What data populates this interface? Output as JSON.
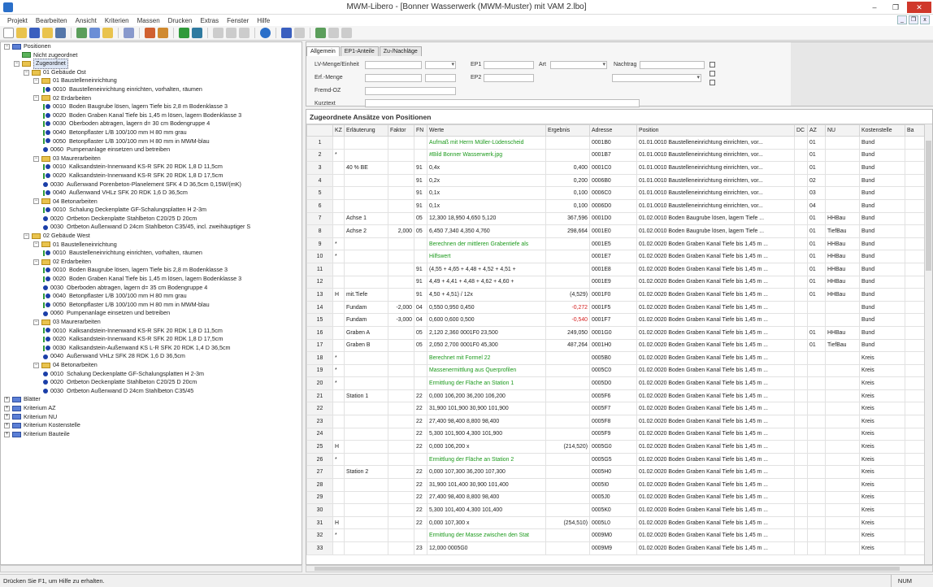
{
  "window": {
    "title": "MWM-Libero - [Bonner Wasserwerk (MWM-Muster) mit VAM 2.lbo]",
    "min_label": "–",
    "max_label": "❐",
    "close_label": "✕"
  },
  "menu": [
    "Projekt",
    "Bearbeiten",
    "Ansicht",
    "Kriterien",
    "Massen",
    "Drucken",
    "Extras",
    "Fenster",
    "Hilfe"
  ],
  "mdi_buttons": [
    "_",
    "❐",
    "x"
  ],
  "tree": {
    "items": [
      {
        "level": 0,
        "exp": "−",
        "icon": "folder-blue",
        "num": "",
        "text": "Positionen"
      },
      {
        "level": 1,
        "exp": "",
        "icon": "folder-green",
        "num": "",
        "text": "Nicht zugeordnet"
      },
      {
        "level": 1,
        "exp": "−",
        "icon": "folder",
        "num": "",
        "text": "Zugeordnet",
        "selected": true
      },
      {
        "level": 2,
        "exp": "−",
        "icon": "folder",
        "num": "",
        "text": "01 Gebäude Ost"
      },
      {
        "level": 3,
        "exp": "−",
        "icon": "folder",
        "num": "",
        "text": "01 Baustelleneinrichtung"
      },
      {
        "level": 4,
        "exp": "",
        "icon": "marks-gd",
        "num": "0010",
        "text": "Baustelleneinrichtung einrichten, vorhalten, räumen"
      },
      {
        "level": 3,
        "exp": "−",
        "icon": "folder",
        "num": "",
        "text": "02 Erdarbeiten"
      },
      {
        "level": 4,
        "exp": "",
        "icon": "marks-gd",
        "num": "0010",
        "text": "Boden Baugrube lösen, lagern Tiefe bis 2,8 m Bodenklasse 3"
      },
      {
        "level": 4,
        "exp": "",
        "icon": "marks-rgd",
        "num": "0020",
        "text": "Boden Graben Kanal Tiefe bis 1,45 m lösen, lagern Bodenklasse 3"
      },
      {
        "level": 4,
        "exp": "",
        "icon": "marks-gd",
        "num": "0030",
        "text": "Oberboden abtragen, lagern d= 30 cm Bodengruppe 4"
      },
      {
        "level": 4,
        "exp": "",
        "icon": "marks-gd",
        "num": "0040",
        "text": "Betonpflaster L/B 100/100 mm H 80 mm grau"
      },
      {
        "level": 4,
        "exp": "",
        "icon": "marks-gd",
        "num": "0050",
        "text": "Betonpflaster L/B 100/100 mm H 80 mm in MWM-blau"
      },
      {
        "level": 4,
        "exp": "",
        "icon": "marks-d",
        "num": "0060",
        "text": "Pumpenanlage einsetzen und betreiben"
      },
      {
        "level": 3,
        "exp": "−",
        "icon": "folder",
        "num": "",
        "text": "03 Maurerarbeiten"
      },
      {
        "level": 4,
        "exp": "",
        "icon": "marks-gd",
        "num": "0010",
        "text": "Kalksandstein-Innenwand KS-R SFK 20 RDK 1,8 D 11,5cm"
      },
      {
        "level": 4,
        "exp": "",
        "icon": "marks-gd",
        "num": "0020",
        "text": "Kalksandstein-Innenwand KS-R SFK 20 RDK 1,8 D 17,5cm"
      },
      {
        "level": 4,
        "exp": "",
        "icon": "marks-d",
        "num": "0030",
        "text": "Außenwand Porenbeton-Planelement SFK 4 D 36,5cm 0,15W/(mK)"
      },
      {
        "level": 4,
        "exp": "",
        "icon": "marks-gd",
        "num": "0040",
        "text": "Außenwand VHLz SFK 20 RDK 1,6 D 36,5cm"
      },
      {
        "level": 3,
        "exp": "−",
        "icon": "folder",
        "num": "",
        "text": "04 Betonarbeiten"
      },
      {
        "level": 4,
        "exp": "",
        "icon": "marks-gd",
        "num": "0010",
        "text": "Schalung Deckenplatte GF-Schalungsplatten H 2-3m"
      },
      {
        "level": 4,
        "exp": "",
        "icon": "marks-d",
        "num": "0020",
        "text": "Ortbeton Deckenplatte Stahlbeton C20/25 D 20cm"
      },
      {
        "level": 4,
        "exp": "",
        "icon": "marks-d",
        "num": "0030",
        "text": "Ortbeton Außenwand D 24cm Stahlbeton C35/45, incl. zweihäuptiger S"
      },
      {
        "level": 2,
        "exp": "−",
        "icon": "folder",
        "num": "",
        "text": "02 Gebäude West"
      },
      {
        "level": 3,
        "exp": "−",
        "icon": "folder",
        "num": "",
        "text": "01 Baustelleneinrichtung"
      },
      {
        "level": 4,
        "exp": "",
        "icon": "marks-gd",
        "num": "0010",
        "text": "Baustelleneinrichtung einrichten, vorhalten, räumen"
      },
      {
        "level": 3,
        "exp": "−",
        "icon": "folder",
        "num": "",
        "text": "02 Erdarbeiten"
      },
      {
        "level": 4,
        "exp": "",
        "icon": "marks-gd",
        "num": "0010",
        "text": "Boden Baugrube lösen, lagern Tiefe bis 2,8 m Bodenklasse 3"
      },
      {
        "level": 4,
        "exp": "",
        "icon": "marks-rgd",
        "num": "0020",
        "text": "Boden Graben Kanal Tiefe bis 1,45 m lösen, lagern Bodenklasse 3"
      },
      {
        "level": 4,
        "exp": "",
        "icon": "marks-d",
        "num": "0030",
        "text": "Oberboden abtragen, lagern d= 35 cm Bodengruppe 4"
      },
      {
        "level": 4,
        "exp": "",
        "icon": "marks-gd",
        "num": "0040",
        "text": "Betonpflaster L/B 100/100 mm H 80 mm grau"
      },
      {
        "level": 4,
        "exp": "",
        "icon": "marks-gd",
        "num": "0050",
        "text": "Betonpflaster L/B 100/100 mm H 80 mm in MWM-blau"
      },
      {
        "level": 4,
        "exp": "",
        "icon": "marks-d",
        "num": "0060",
        "text": "Pumpenanlage einsetzen und betreiben"
      },
      {
        "level": 3,
        "exp": "−",
        "icon": "folder",
        "num": "",
        "text": "03 Maurerarbeiten"
      },
      {
        "level": 4,
        "exp": "",
        "icon": "marks-gd",
        "num": "0010",
        "text": "Kalksandstein-Innenwand KS-R SFK 20 RDK 1,8 D 11,5cm"
      },
      {
        "level": 4,
        "exp": "",
        "icon": "marks-gd",
        "num": "0020",
        "text": "Kalksandstein-Innenwand KS-R SFK 20 RDK 1,8 D 17,5cm"
      },
      {
        "level": 4,
        "exp": "",
        "icon": "marks-gd",
        "num": "0030",
        "text": "Kalksandstein-Außenwand KS L-R SFK 20 RDK 1,4 D 36,5cm"
      },
      {
        "level": 4,
        "exp": "",
        "icon": "marks-d",
        "num": "0040",
        "text": "Außenwand VHLz SFK 28 RDK 1,6 D 36,5cm"
      },
      {
        "level": 3,
        "exp": "−",
        "icon": "folder",
        "num": "",
        "text": "04 Betonarbeiten"
      },
      {
        "level": 4,
        "exp": "",
        "icon": "marks-d",
        "num": "0010",
        "text": "Schalung Deckenplatte GF-Schalungsplatten H 2-3m"
      },
      {
        "level": 4,
        "exp": "",
        "icon": "marks-d",
        "num": "0020",
        "text": "Ortbeton Deckenplatte Stahlbeton C20/25 D 20cm"
      },
      {
        "level": 4,
        "exp": "",
        "icon": "marks-d",
        "num": "0030",
        "text": "Ortbeton Außenwand D 24cm Stahlbeton C35/45"
      },
      {
        "level": 0,
        "exp": "+",
        "icon": "folder-blue",
        "num": "",
        "text": "Blätter"
      },
      {
        "level": 0,
        "exp": "+",
        "icon": "folder-blue",
        "num": "",
        "text": "Kriterium AZ"
      },
      {
        "level": 0,
        "exp": "+",
        "icon": "folder-blue",
        "num": "",
        "text": "Kriterium NU"
      },
      {
        "level": 0,
        "exp": "+",
        "icon": "folder-blue",
        "num": "",
        "text": "Kriterium Kostenstelle"
      },
      {
        "level": 0,
        "exp": "+",
        "icon": "folder-blue",
        "num": "",
        "text": "Kriterium Bauteile"
      }
    ]
  },
  "props": {
    "tabs": [
      "Allgemein",
      "EP1-Anteile",
      "Zu-/Nachläge"
    ],
    "labels": {
      "lv_menge": "LV-Menge/Einheit",
      "erf_menge": "Erf.-Menge",
      "fremd_oz": "Fremd-OZ",
      "kurztext": "Kurztext",
      "ep1": "EP1",
      "ep2": "EP2",
      "art": "Art",
      "nachtrag": "Nachtrag"
    }
  },
  "grid": {
    "title": "Zugeordnete Ansätze von Positionen",
    "columns": [
      "",
      "KZ",
      "Erläuterung",
      "Faktor",
      "FN",
      "Werte",
      "Ergebnis",
      "Adresse",
      "Position",
      "DC",
      "AZ",
      "NU",
      "Kostenstelle",
      "Ba"
    ],
    "rows": [
      [
        "1",
        "",
        "",
        "",
        "",
        "Aufmaß mit Herrn Müller-Lüdenscheid",
        "",
        "0001B0",
        "01.01.0010  Baustelleneinrichtung einrichten, vor...",
        "",
        "01",
        "",
        "Bund",
        "",
        "green"
      ],
      [
        "2",
        "*",
        "",
        "",
        "",
        "#Bild Bonner Wasserwerk.jpg",
        "",
        "0001B7",
        "01.01.0010  Baustelleneinrichtung einrichten, vor...",
        "",
        "01",
        "",
        "Bund",
        "",
        "green"
      ],
      [
        "3",
        "",
        "40 % BE",
        "",
        "91",
        "0,4x",
        "0,400",
        "0001C0",
        "01.01.0010  Baustelleneinrichtung einrichten, vor...",
        "",
        "01",
        "",
        "Bund",
        "",
        ""
      ],
      [
        "4",
        "",
        "",
        "",
        "91",
        "0,2x",
        "0,200",
        "0006B0",
        "01.01.0010  Baustelleneinrichtung einrichten, vor...",
        "",
        "02",
        "",
        "Bund",
        "",
        ""
      ],
      [
        "5",
        "",
        "",
        "",
        "91",
        "0,1x",
        "0,100",
        "0006C0",
        "01.01.0010  Baustelleneinrichtung einrichten, vor...",
        "",
        "03",
        "",
        "Bund",
        "",
        ""
      ],
      [
        "6",
        "",
        "",
        "",
        "91",
        "0,1x",
        "0,100",
        "0006D0",
        "01.01.0010  Baustelleneinrichtung einrichten, vor...",
        "",
        "04",
        "",
        "Bund",
        "",
        ""
      ],
      [
        "7",
        "",
        "Achse 1",
        "",
        "05",
        "12,300 18,950 4,650 5,120",
        "367,596",
        "0001D0",
        "01.02.0010  Boden Baugrube lösen, lagern Tiefe ...",
        "",
        "01",
        "HHBau",
        "Bund",
        "",
        ""
      ],
      [
        "8",
        "",
        "Achse 2",
        "2,000",
        "05",
        "6,450 7,340 4,350 4,760",
        "298,664",
        "0001E0",
        "01.02.0010  Boden Baugrube lösen, lagern Tiefe ...",
        "",
        "01",
        "TiefBau",
        "Bund",
        "",
        ""
      ],
      [
        "9",
        "*",
        "",
        "",
        "",
        "Berechnen der mittleren Grabentiefe als",
        "",
        "0001E5",
        "01.02.0020  Boden Graben Kanal Tiefe bis 1,45 m ...",
        "",
        "01",
        "HHBau",
        "Bund",
        "",
        "green"
      ],
      [
        "10",
        "*",
        "",
        "",
        "",
        "Hilfswert",
        "",
        "0001E7",
        "01.02.0020  Boden Graben Kanal Tiefe bis 1,45 m ...",
        "",
        "01",
        "HHBau",
        "Bund",
        "",
        "green"
      ],
      [
        "11",
        "",
        "",
        "",
        "91",
        "(4,55 + 4,65 + 4,48 + 4,52 + 4,51 +",
        "",
        "0001E8",
        "01.02.0020  Boden Graben Kanal Tiefe bis 1,45 m ...",
        "",
        "01",
        "HHBau",
        "Bund",
        "",
        ""
      ],
      [
        "12",
        "",
        "",
        "",
        "91",
        "4,49 + 4,41 + 4,48 + 4,62 + 4,60 +",
        "",
        "0001E9",
        "01.02.0020  Boden Graben Kanal Tiefe bis 1,45 m ...",
        "",
        "01",
        "HHBau",
        "Bund",
        "",
        ""
      ],
      [
        "13",
        "H",
        "mit.Tiefe",
        "",
        "91",
        "4,50 + 4,51) / 12x",
        "(4,529)",
        "0001F0",
        "01.02.0020  Boden Graben Kanal Tiefe bis 1,45 m ...",
        "",
        "01",
        "HHBau",
        "Bund",
        "",
        ""
      ],
      [
        "14",
        "",
        "Fundam",
        "-2,000",
        "04",
        "0,550 0,950 0,450",
        "-0,272",
        "0001F5",
        "01.02.0020  Boden Graben Kanal Tiefe bis 1,45 m ...",
        "",
        "",
        "",
        "Bund",
        "",
        "red"
      ],
      [
        "15",
        "",
        "Fundam",
        "-3,000",
        "04",
        "0,600 0,600 0,500",
        "-0,540",
        "0001F7",
        "01.02.0020  Boden Graben Kanal Tiefe bis 1,45 m ...",
        "",
        "",
        "",
        "Bund",
        "",
        "red"
      ],
      [
        "16",
        "",
        "Graben A",
        "",
        "05",
        "2,120 2,360 0001F0 23,500",
        "249,050",
        "0001G0",
        "01.02.0020  Boden Graben Kanal Tiefe bis 1,45 m ...",
        "",
        "01",
        "HHBau",
        "Bund",
        "",
        ""
      ],
      [
        "17",
        "",
        "Graben B",
        "",
        "05",
        "2,050 2,700 0001F0 45,300",
        "487,264",
        "0001H0",
        "01.02.0020  Boden Graben Kanal Tiefe bis 1,45 m ...",
        "",
        "01",
        "TiefBau",
        "Bund",
        "",
        ""
      ],
      [
        "18",
        "*",
        "",
        "",
        "",
        "Berechnet mit Formel 22",
        "",
        "0005B0",
        "01.02.0020  Boden Graben Kanal Tiefe bis 1,45 m ...",
        "",
        "",
        "",
        "Kreis",
        "",
        "green"
      ],
      [
        "19",
        "*",
        "",
        "",
        "",
        "Massenermittlung aus Querprofilen",
        "",
        "0005C0",
        "01.02.0020  Boden Graben Kanal Tiefe bis 1,45 m ...",
        "",
        "",
        "",
        "Kreis",
        "",
        "green"
      ],
      [
        "20",
        "*",
        "",
        "",
        "",
        "Ermittlung der Fläche an Station 1",
        "",
        "0005D0",
        "01.02.0020  Boden Graben Kanal Tiefe bis 1,45 m ...",
        "",
        "",
        "",
        "Kreis",
        "",
        "green"
      ],
      [
        "21",
        "",
        "Station 1",
        "",
        "22",
        "0,000 106,200 36,200 106,200",
        "",
        "0005F6",
        "01.02.0020  Boden Graben Kanal Tiefe bis 1,45 m ...",
        "",
        "",
        "",
        "Kreis",
        "",
        ""
      ],
      [
        "22",
        "",
        "",
        "",
        "22",
        "31,900 101,900 30,900 101,900",
        "",
        "0005F7",
        "01.02.0020  Boden Graben Kanal Tiefe bis 1,45 m ...",
        "",
        "",
        "",
        "Kreis",
        "",
        ""
      ],
      [
        "23",
        "",
        "",
        "",
        "22",
        "27,400 98,400 8,800 98,400",
        "",
        "0005F8",
        "01.02.0020  Boden Graben Kanal Tiefe bis 1,45 m ...",
        "",
        "",
        "",
        "Kreis",
        "",
        ""
      ],
      [
        "24",
        "",
        "",
        "",
        "22",
        "5,300 101,900 4,300 101,900",
        "",
        "0005F9",
        "01.02.0020  Boden Graben Kanal Tiefe bis 1,45 m ...",
        "",
        "",
        "",
        "Kreis",
        "",
        ""
      ],
      [
        "25",
        "H",
        "",
        "",
        "22",
        "0,000 106,200 x",
        "(214,520)",
        "0005G0",
        "01.02.0020  Boden Graben Kanal Tiefe bis 1,45 m ...",
        "",
        "",
        "",
        "Kreis",
        "",
        ""
      ],
      [
        "26",
        "*",
        "",
        "",
        "",
        "Ermittlung der Fläche an Station 2",
        "",
        "0005G5",
        "01.02.0020  Boden Graben Kanal Tiefe bis 1,45 m ...",
        "",
        "",
        "",
        "Kreis",
        "",
        "green"
      ],
      [
        "27",
        "",
        "Station 2",
        "",
        "22",
        "0,000 107,300 36,200 107,300",
        "",
        "0005H0",
        "01.02.0020  Boden Graben Kanal Tiefe bis 1,45 m ...",
        "",
        "",
        "",
        "Kreis",
        "",
        ""
      ],
      [
        "28",
        "",
        "",
        "",
        "22",
        "31,900 101,400 30,900 101,400",
        "",
        "0005I0",
        "01.02.0020  Boden Graben Kanal Tiefe bis 1,45 m ...",
        "",
        "",
        "",
        "Kreis",
        "",
        ""
      ],
      [
        "29",
        "",
        "",
        "",
        "22",
        "27,400 98,400 8,800 98,400",
        "",
        "0005J0",
        "01.02.0020  Boden Graben Kanal Tiefe bis 1,45 m ...",
        "",
        "",
        "",
        "Kreis",
        "",
        ""
      ],
      [
        "30",
        "",
        "",
        "",
        "22",
        "5,300 101,400 4,300 101,400",
        "",
        "0005K0",
        "01.02.0020  Boden Graben Kanal Tiefe bis 1,45 m ...",
        "",
        "",
        "",
        "Kreis",
        "",
        ""
      ],
      [
        "31",
        "H",
        "",
        "",
        "22",
        "0,000 107,300 x",
        "(254,510)",
        "0005L0",
        "01.02.0020  Boden Graben Kanal Tiefe bis 1,45 m ...",
        "",
        "",
        "",
        "Kreis",
        "",
        ""
      ],
      [
        "32",
        "*",
        "",
        "",
        "",
        "Ermittlung der Masse zwischen den Stat",
        "",
        "0009M0",
        "01.02.0020  Boden Graben Kanal Tiefe bis 1,45 m ...",
        "",
        "",
        "",
        "Kreis",
        "",
        "green"
      ],
      [
        "33",
        "",
        "",
        "",
        "23",
        "12,000 0005G0",
        "",
        "0009M9",
        "01.02.0020  Boden Graben Kanal Tiefe bis 1,45 m ...",
        "",
        "",
        "",
        "Kreis",
        "",
        ""
      ]
    ]
  },
  "status": {
    "message": "Drücken Sie F1, um Hilfe zu erhalten.",
    "num": "NUM"
  },
  "colors": {
    "green_text": "#1c9a1c",
    "red_text": "#d42020",
    "folder": "#e9c34d",
    "tree_dot": "#1b3fa8"
  }
}
